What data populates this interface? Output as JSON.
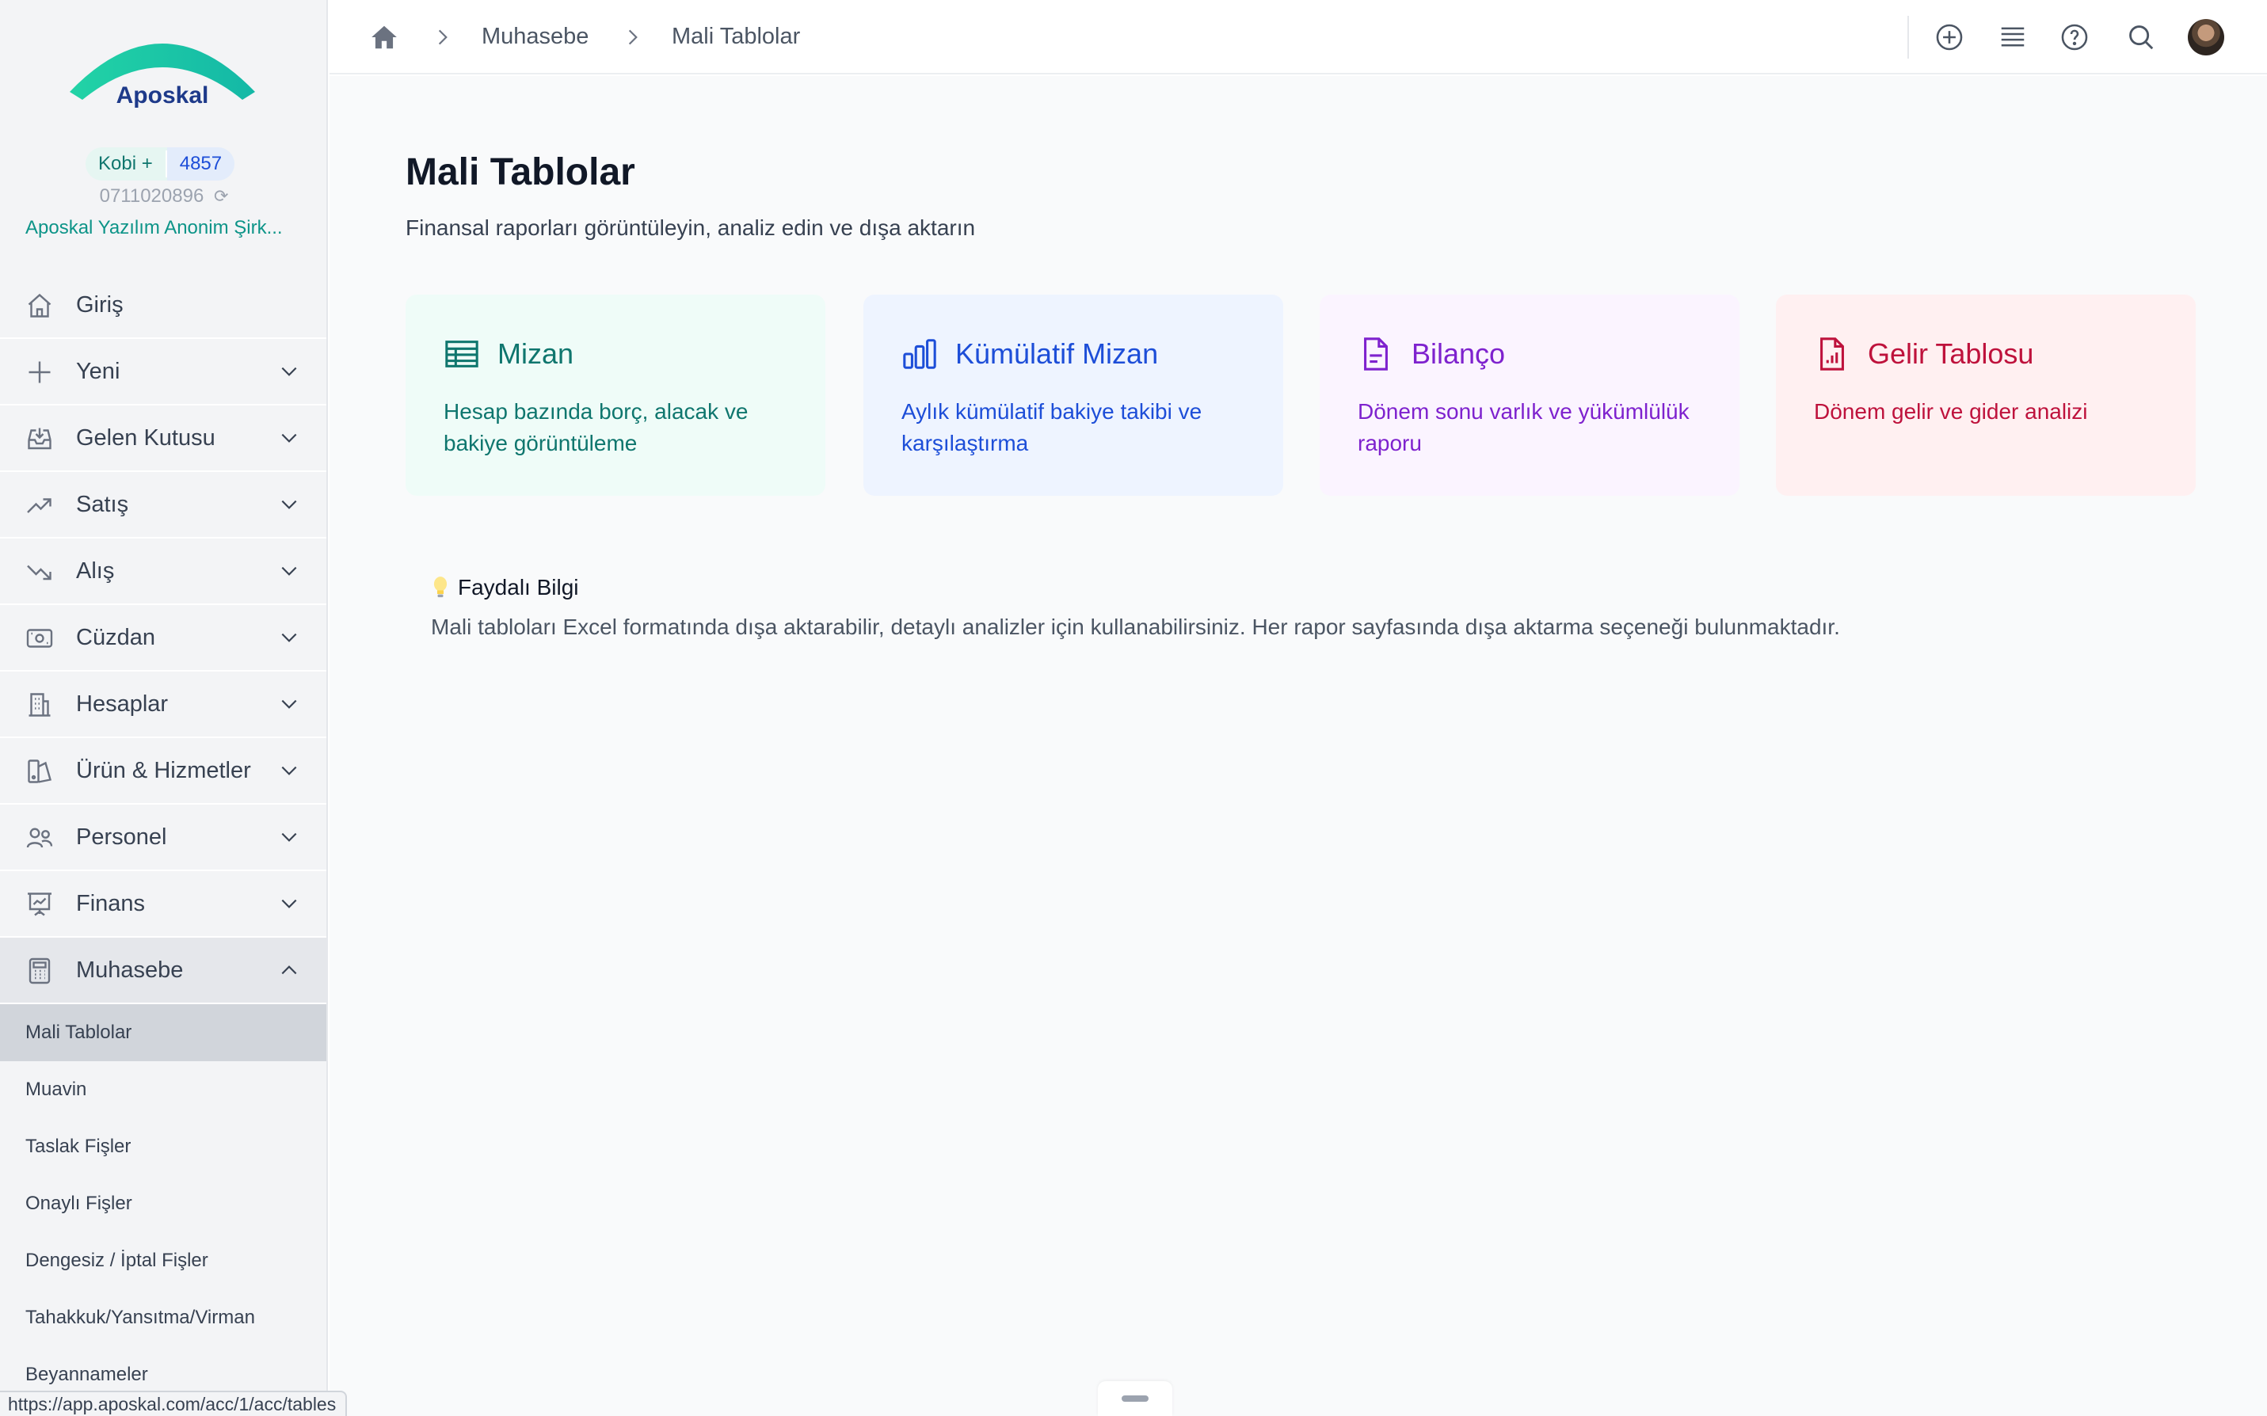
{
  "brand": {
    "name": "Aposkal",
    "logo_icon": "aposkal-arc-logo",
    "accent": "#2dd4bf"
  },
  "account": {
    "plan": "Kobi +",
    "plan_number": "4857",
    "tax_id": "0711020896",
    "company": "Aposkal Yazılım Anonim Şirk..."
  },
  "sidebar": {
    "items": [
      {
        "label": "Giriş",
        "icon": "home-outline-icon",
        "expandable": false
      },
      {
        "label": "Yeni",
        "icon": "plus-icon",
        "expandable": true
      },
      {
        "label": "Gelen Kutusu",
        "icon": "inbox-icon",
        "expandable": true
      },
      {
        "label": "Satış",
        "icon": "trending-up-icon",
        "expandable": true
      },
      {
        "label": "Alış",
        "icon": "trending-down-icon",
        "expandable": true
      },
      {
        "label": "Cüzdan",
        "icon": "wallet-icon",
        "expandable": true
      },
      {
        "label": "Hesaplar",
        "icon": "building-icon",
        "expandable": true
      },
      {
        "label": "Ürün & Hizmetler",
        "icon": "product-icon",
        "expandable": true
      },
      {
        "label": "Personel",
        "icon": "users-icon",
        "expandable": true
      },
      {
        "label": "Finans",
        "icon": "presentation-chart-icon",
        "expandable": true
      },
      {
        "label": "Muhasebe",
        "icon": "calculator-icon",
        "expandable": true,
        "open": true
      }
    ],
    "submenu": [
      {
        "label": "Mali Tablolar",
        "active": true
      },
      {
        "label": "Muavin"
      },
      {
        "label": "Taslak Fişler"
      },
      {
        "label": "Onaylı Fişler"
      },
      {
        "label": "Dengesiz / İptal Fişler"
      },
      {
        "label": "Tahakkuk/Yansıtma/Virman"
      },
      {
        "label": "Beyannameler"
      }
    ]
  },
  "status_url": "https://app.aposkal.com/acc/1/acc/tables",
  "breadcrumb": {
    "items": [
      "Muhasebe",
      "Mali Tablolar"
    ]
  },
  "topbar": {
    "icons": [
      "add-circle-icon",
      "list-icon",
      "help-icon",
      "search-icon",
      "avatar"
    ]
  },
  "page": {
    "title": "Mali Tablolar",
    "subtitle": "Finansal raporları görüntüleyin, analiz edin ve dışa aktarın"
  },
  "cards": [
    {
      "title": "Mizan",
      "description": "Hesap bazında borç, alacak ve bakiye görüntüleme",
      "icon": "table-icon",
      "bg": "#effcf8",
      "color": "#0f766e"
    },
    {
      "title": "Kümülatif Mizan",
      "description": "Aylık kümülatif bakiye takibi ve karşılaştırma",
      "icon": "bar-chart-icon",
      "bg": "#eef4ff",
      "color": "#1d4ed8"
    },
    {
      "title": "Bilanço",
      "description": "Dönem sonu varlık ve yükümlülük raporu",
      "icon": "document-icon",
      "bg": "#fbf4ff",
      "color": "#7e22ce"
    },
    {
      "title": "Gelir Tablosu",
      "description": "Dönem gelir ve gider analizi",
      "icon": "document-chart-icon",
      "bg": "#fff0f1",
      "color": "#be123c"
    }
  ],
  "tip": {
    "icon": "lightbulb-icon",
    "title": "Faydalı Bilgi",
    "text": "Mali tabloları Excel formatında dışa aktarabilir, detaylı analizler için kullanabilirsiniz. Her rapor sayfasında dışa aktarma seçeneği bulunmaktadır."
  }
}
